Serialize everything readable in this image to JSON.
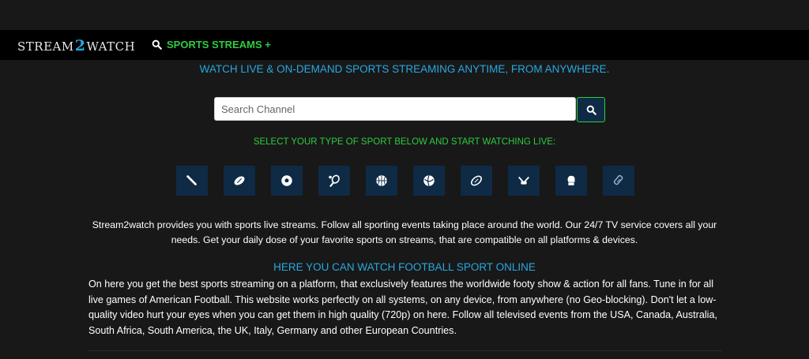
{
  "brand": {
    "logo_left": "STREAM",
    "logo_mark": "2",
    "logo_right": "WATCH"
  },
  "nav": {
    "sports_streams_label": "SPORTS STREAMS +"
  },
  "headline": "WATCH LIVE & ON-DEMAND SPORTS STREAMING ANYTIME, FROM ANYWHERE.",
  "search": {
    "placeholder": "Search Channel",
    "value": ""
  },
  "select_prompt": "SELECT YOUR TYPE OF SPORT BELOW AND START WATCHING LIVE:",
  "sports": [
    {
      "icon": "baseball-bat-icon"
    },
    {
      "icon": "football-icon"
    },
    {
      "icon": "soccer-ball-icon"
    },
    {
      "icon": "tennis-racket-icon"
    },
    {
      "icon": "basketball-icon"
    },
    {
      "icon": "volleyball-icon"
    },
    {
      "icon": "rugby-ball-icon"
    },
    {
      "icon": "hockey-icon"
    },
    {
      "icon": "boxing-glove-icon"
    },
    {
      "icon": "cricket-icon"
    }
  ],
  "description": "Stream2watch provides you with sports live streams. Follow all sporting events taking place around the world. Our 24/7 TV service covers all your needs. Get your daily dose of your favorite sports on streams, that are compatible on all platforms & devices.",
  "subheading": "HERE YOU CAN WATCH FOOTBALL SPORT ONLINE",
  "body": "On here you get the best sports streaming on a platform, that exclusively features the worldwide footy show & action for all fans. Tune in for all live games of American Football. This website works perfectly on all systems, on any device, from anywhere (no Geo-blocking). Don't let a low-quality video hurt your eyes when you can get them in high quality (720p) on here. Follow all televised events from the USA, Canada, Australia, South Africa, South America, the UK, Italy, Germany and other European Countries.",
  "colors": {
    "accent_blue": "#27a8e0",
    "accent_green": "#2ecc40",
    "tile_bg": "#0e2a45"
  }
}
